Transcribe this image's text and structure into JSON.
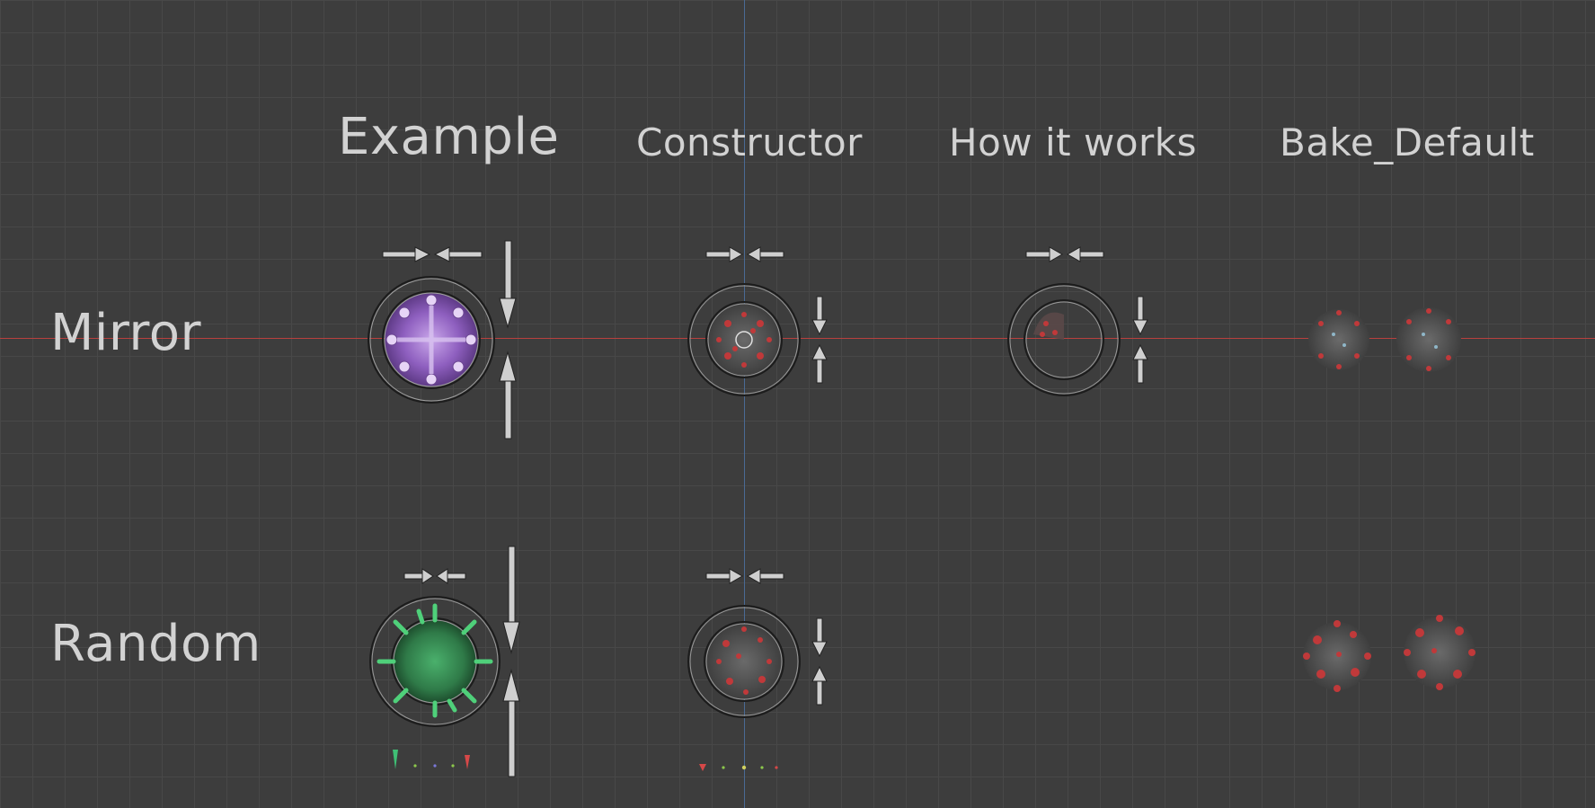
{
  "columns": {
    "example": "Example",
    "constructor": "Constructor",
    "how_it_works": "How it works",
    "bake_default": "Bake_Default"
  },
  "rows": {
    "mirror": "Mirror",
    "random": "Random"
  },
  "colors": {
    "background": "#3d3d3d",
    "grid": "#484848",
    "x_axis": "#b8413e",
    "y_axis": "#4a6a94",
    "label_text": "#d2d2d2",
    "mirror_example_object": "#9a6fc4",
    "random_example_object": "#3e9a5a",
    "baked_object_accent": "#c0393a"
  }
}
